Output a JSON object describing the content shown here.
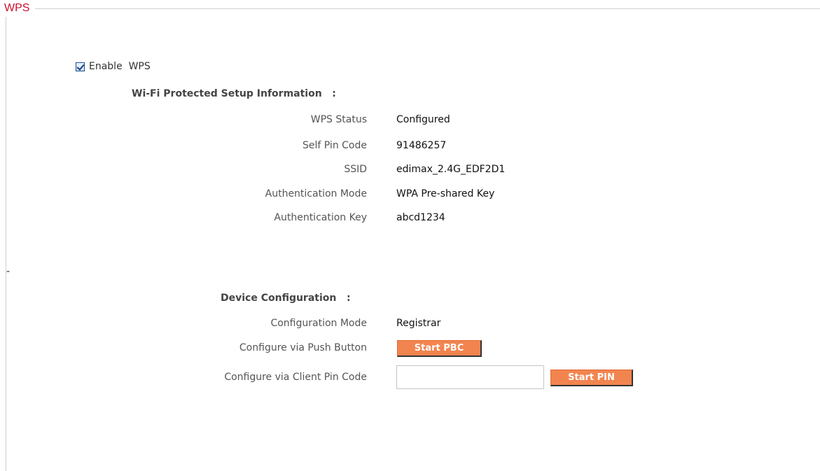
{
  "legend": "WPS",
  "enable": {
    "label": "Enable  WPS",
    "checked": true
  },
  "wps_info": {
    "title": "Wi-Fi Protected Setup Information   :",
    "rows": [
      {
        "label": "WPS Status",
        "value": "Configured"
      },
      {
        "label": "Self Pin Code",
        "value": "91486257"
      },
      {
        "label": "SSID",
        "value": "edimax_2.4G_EDF2D1"
      },
      {
        "label": "Authentication Mode",
        "value": "WPA Pre-shared Key"
      },
      {
        "label": "Authentication Key",
        "value": "abcd1234"
      }
    ]
  },
  "separator": "-",
  "device_config": {
    "title": "Device Configuration   :",
    "mode_label": "Configuration Mode",
    "mode_value": "Registrar",
    "push_label": "Configure via Push Button",
    "push_button": "Start PBC",
    "pin_label": "Configure via Client Pin Code",
    "pin_value": "",
    "pin_button": "Start PIN"
  },
  "colors": {
    "legend": "#c8102e",
    "button": "#f2844f"
  }
}
